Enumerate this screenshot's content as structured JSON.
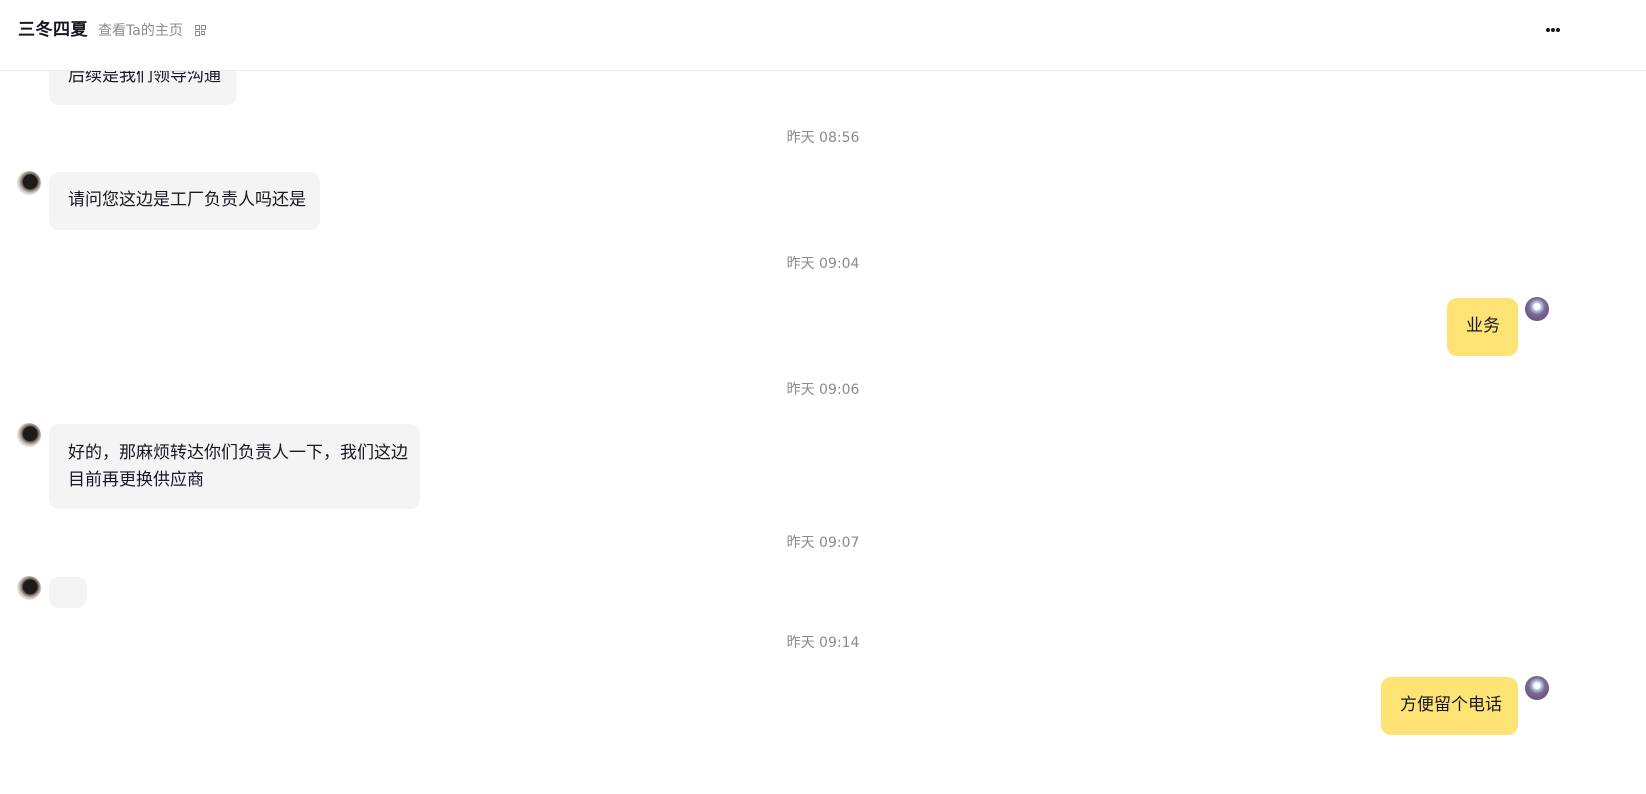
{
  "header": {
    "contact_name": "三冬四夏",
    "profile_link": "查看Ta的主页",
    "qr_icon": "qr-code-icon",
    "more_icon": "more-horizontal-icon"
  },
  "messages": [
    {
      "type": "incoming",
      "text": "后续是我们领导沟通",
      "partially_hidden": true
    },
    {
      "type": "timestamp",
      "text": "昨天 08:56"
    },
    {
      "type": "incoming",
      "text": "请问您这边是工厂负责人吗还是"
    },
    {
      "type": "timestamp",
      "text": "昨天 09:04"
    },
    {
      "type": "outgoing",
      "text": "业务"
    },
    {
      "type": "timestamp",
      "text": "昨天 09:06"
    },
    {
      "type": "incoming",
      "lines": [
        "好的，那麻烦转达你们负责人一下，我们这边",
        "目前再更换供应商"
      ]
    },
    {
      "type": "timestamp",
      "text": "昨天 09:07"
    },
    {
      "type": "incoming",
      "text": ""
    },
    {
      "type": "timestamp",
      "text": "昨天 09:14"
    },
    {
      "type": "outgoing",
      "text": "方便留个电话"
    }
  ],
  "colors": {
    "incoming_bubble": "#f4f4f4",
    "outgoing_bubble": "#fde274",
    "timestamp_text": "#8a8b91",
    "primary_text": "#161823"
  }
}
